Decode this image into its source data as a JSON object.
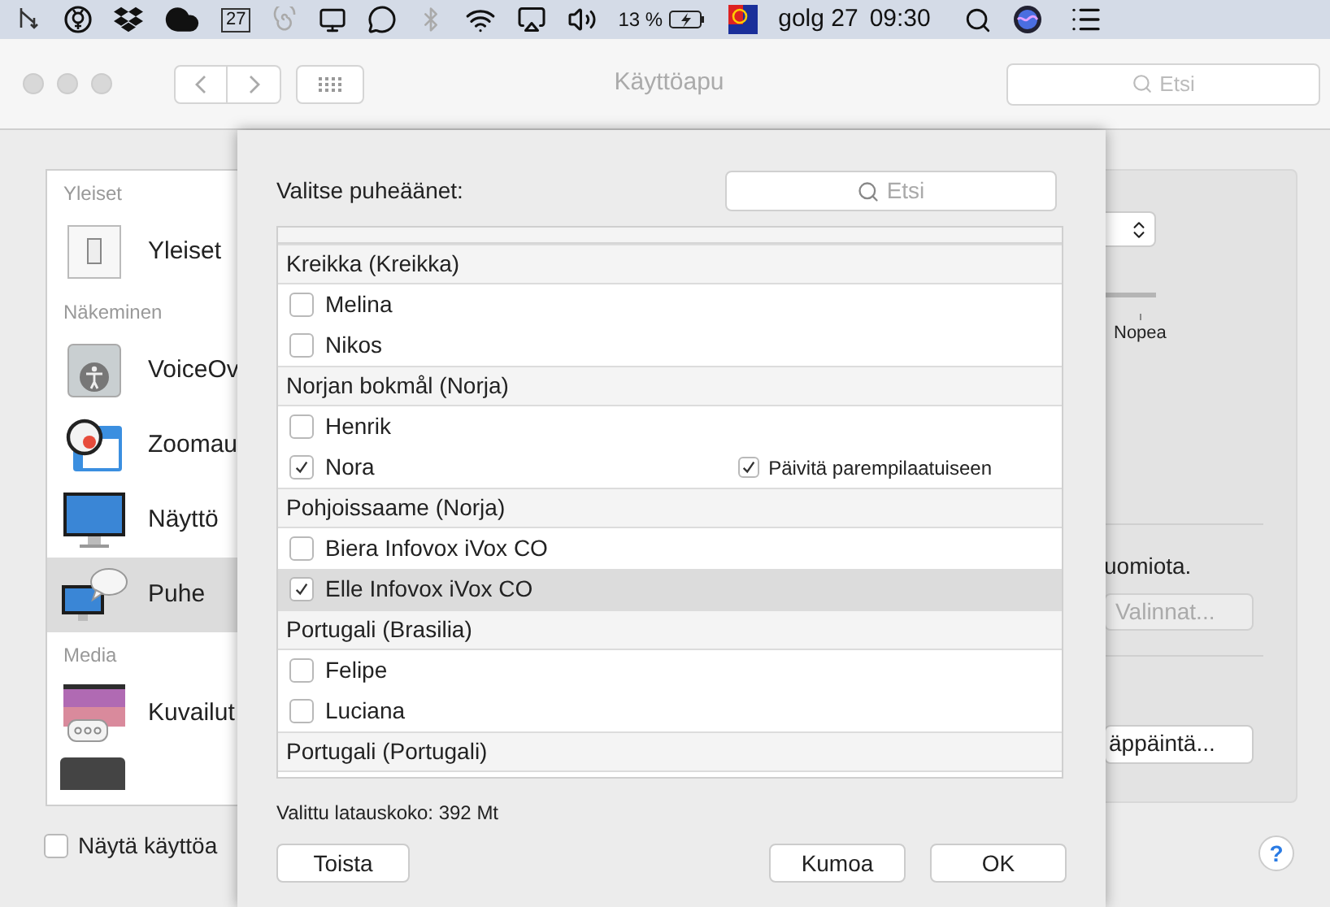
{
  "menubar": {
    "calendar_day": "27",
    "battery": "13 %",
    "date": "golg 27",
    "time": "09:30"
  },
  "window": {
    "title": "Käyttöapu",
    "search": {
      "placeholder": "Etsi"
    }
  },
  "sidebar": {
    "sections": [
      {
        "header": "Yleiset",
        "items": [
          {
            "label": "Yleiset",
            "kind": "switch",
            "selected": false
          }
        ]
      },
      {
        "header": "Näkeminen",
        "items": [
          {
            "label": "VoiceOv",
            "kind": "voiceover",
            "selected": false
          },
          {
            "label": "Zoomau",
            "kind": "zoom",
            "selected": false
          },
          {
            "label": "Näyttö",
            "kind": "display",
            "selected": false
          },
          {
            "label": "Puhe",
            "kind": "speech",
            "selected": true
          }
        ]
      },
      {
        "header": "Media",
        "items": [
          {
            "label": "Kuvailut",
            "kind": "captions",
            "selected": false
          }
        ]
      }
    ]
  },
  "show_checkbox": {
    "label": "Näytä käyttöa",
    "checked": false
  },
  "right_panel": {
    "slider_label": "Nopea",
    "text": "uomiota.",
    "options_button": {
      "label": "Valinnat...",
      "disabled": true
    },
    "key_button": {
      "label": "äppäintä..."
    }
  },
  "help_button": {
    "label": "?"
  },
  "sheet": {
    "title": "Valitse puheäänet:",
    "search": {
      "placeholder": "Etsi"
    },
    "groups": [
      {
        "name": "Kreikka (Kreikka)",
        "voices": [
          {
            "name": "Melina",
            "checked": false,
            "selected": false
          },
          {
            "name": "Nikos",
            "checked": false,
            "selected": false
          }
        ]
      },
      {
        "name": "Norjan bokmål (Norja)",
        "voices": [
          {
            "name": "Henrik",
            "checked": false,
            "selected": false
          },
          {
            "name": "Nora",
            "checked": true,
            "selected": false,
            "upgrade": {
              "label": "Päivitä parempilaatuiseen",
              "checked": true
            }
          }
        ]
      },
      {
        "name": "Pohjoissaame (Norja)",
        "voices": [
          {
            "name": "Biera Infovox iVox CO",
            "checked": false,
            "selected": false
          },
          {
            "name": "Elle Infovox iVox CO",
            "checked": true,
            "selected": true
          }
        ]
      },
      {
        "name": "Portugali (Brasilia)",
        "voices": [
          {
            "name": "Felipe",
            "checked": false,
            "selected": false
          },
          {
            "name": "Luciana",
            "checked": false,
            "selected": false
          }
        ]
      },
      {
        "name": "Portugali (Portugali)"
      }
    ],
    "download_size": "Valittu latauskoko: 392 Mt",
    "buttons": {
      "play": "Toista",
      "cancel": "Kumoa",
      "ok": "OK"
    }
  }
}
